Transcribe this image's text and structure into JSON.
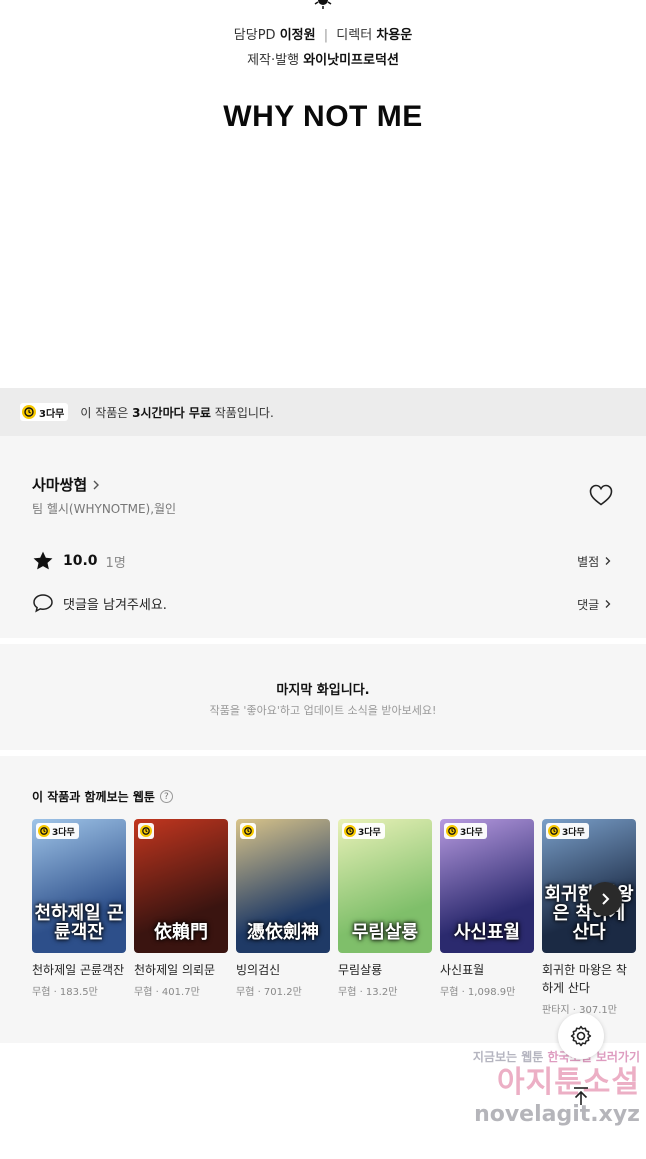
{
  "credits": {
    "line1": {
      "label1": "담당PD",
      "name1": "이정원",
      "sep": "|",
      "label2": "디렉터",
      "name2": "차용운"
    },
    "line2": {
      "label": "제작·발행",
      "name": "와이낫미프로덕션"
    },
    "brand": "WHY NOT ME"
  },
  "free_bar": {
    "badge": "3다무",
    "text_pre": "이 작품은 ",
    "text_bold": "3시간마다 무료",
    "text_post": " 작품입니다."
  },
  "work": {
    "title": "사마쌍협",
    "authors": "팀 헬시(WHYNOTME),월인",
    "rating": "10.0",
    "rating_count": "1명",
    "rate_link": "별점",
    "comment_prompt": "댓글을 남겨주세요.",
    "comment_link": "댓글"
  },
  "last_episode": {
    "title": "마지막 화입니다.",
    "subtitle": "작품을 '좋아요'하고 업데이트 소식을 받아보세요!"
  },
  "recommendations": {
    "heading": "이 작품과 함께보는 웹툰",
    "help": "?",
    "items": [
      {
        "title": "천하제일 곤륜객잔",
        "meta": "무협 · 183.5만",
        "badge": "3다무",
        "art": "천하제일 곤륜객잔",
        "color1": "#2d4f8a",
        "color2": "#9fc4e8"
      },
      {
        "title": "천하제일 의뢰문",
        "meta": "무협 · 401.7만",
        "badge": "",
        "art": "依賴門",
        "color1": "#3a1410",
        "color2": "#c2361f"
      },
      {
        "title": "빙의검신",
        "meta": "무협 · 701.2만",
        "badge": "",
        "art": "憑依劍神",
        "color1": "#1f3a66",
        "color2": "#d9c48a"
      },
      {
        "title": "무림살룡",
        "meta": "무협 · 13.2만",
        "badge": "3다무",
        "art": "무림살룡",
        "color1": "#7fbf6a",
        "color2": "#e9f1b8"
      },
      {
        "title": "사신표월",
        "meta": "무협 · 1,098.9만",
        "badge": "3다무",
        "art": "사신표월",
        "color1": "#2b2a6e",
        "color2": "#b79ae0"
      },
      {
        "title": "회귀한 마왕은 착하게 산다",
        "meta": "판타지 · 307.1만",
        "badge": "3다무",
        "art": "회귀한 마왕은 착하게 산다",
        "color1": "#1b2a44",
        "color2": "#7a9fc9"
      }
    ]
  },
  "watermark": {
    "line1_a": "지금보는 웹툰",
    "line1_b": "한국소설 보러가기",
    "line2": "아지툰소설",
    "line3": "novelagit.xyz"
  },
  "colors": {
    "accent_yellow": "#f6c800",
    "panel_gray": "#f6f6f6",
    "free_bar_gray": "#ececec"
  },
  "icons": {
    "heart": "heart-icon",
    "star": "star-icon",
    "comment": "comment-icon",
    "next": "chevron-right-icon",
    "settings": "gear-icon",
    "scroll_top": "arrow-up-icon"
  }
}
